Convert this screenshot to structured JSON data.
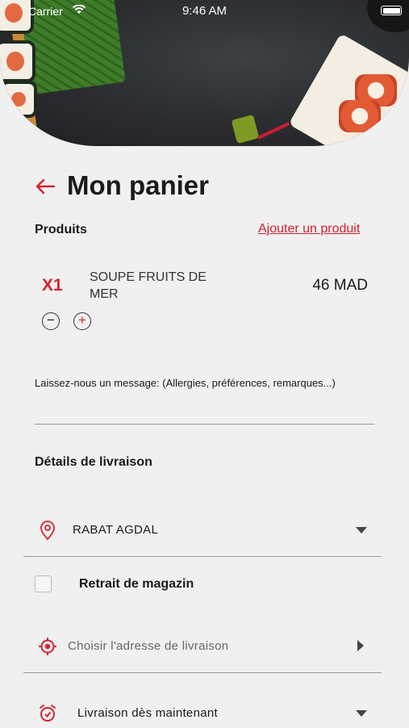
{
  "status_bar": {
    "carrier": "Carrier",
    "time": "9:46 AM"
  },
  "header": {
    "back_icon": "arrow-left-icon",
    "title": "Mon panier"
  },
  "products": {
    "section_title": "Produits",
    "add_link": "Ajouter un produit",
    "items": [
      {
        "quantity": "X1",
        "name": "SOUPE FRUITS DE MER",
        "price": "46 MAD",
        "decrement_symbol": "−",
        "increment_symbol": "+"
      }
    ]
  },
  "message": {
    "placeholder": "Laissez-nous un message: (Allergies, préférences, remarques...)"
  },
  "delivery": {
    "section_title": "Détails de livraison",
    "location": {
      "icon": "map-pin-icon",
      "value": "RABAT AGDAL"
    },
    "pickup": {
      "label": "Retrait de magazin",
      "checked": false
    },
    "address": {
      "icon": "target-icon",
      "placeholder": "Choisir l'adresse de livraison"
    },
    "time": {
      "icon": "alarm-clock-icon",
      "value": "Livraison dès maintenant"
    }
  },
  "colors": {
    "accent": "#d8202f",
    "background": "#f0f0f0",
    "text": "#1a1a1a"
  }
}
